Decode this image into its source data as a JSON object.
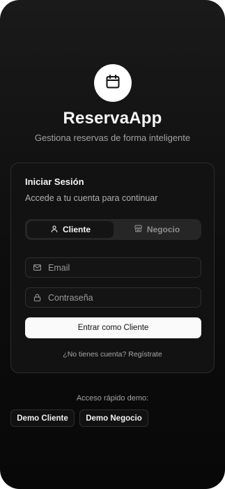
{
  "app": {
    "name": "ReservaApp",
    "tagline": "Gestiona reservas de forma inteligente",
    "logo_icon": "calendar-icon"
  },
  "login": {
    "title": "Iniciar Sesión",
    "subtitle": "Accede a tu cuenta para continuar",
    "tabs": [
      {
        "label": "Cliente",
        "icon": "user-icon",
        "active": true
      },
      {
        "label": "Negocio",
        "icon": "store-icon",
        "active": false
      }
    ],
    "email": {
      "placeholder": "Email",
      "value": "",
      "icon": "mail-icon"
    },
    "password": {
      "placeholder": "Contraseña",
      "value": "",
      "icon": "lock-icon"
    },
    "submit_label": "Entrar como Cliente",
    "signup_text": "¿No tienes cuenta? Regístrate"
  },
  "demo": {
    "label": "Acceso rápido demo:",
    "buttons": [
      "Demo Cliente",
      "Demo Negocio"
    ]
  },
  "colors": {
    "background": "#0d0d0d",
    "card": "#121212",
    "primary_button": "#fafafa",
    "muted_text": "#a3a3a3"
  }
}
